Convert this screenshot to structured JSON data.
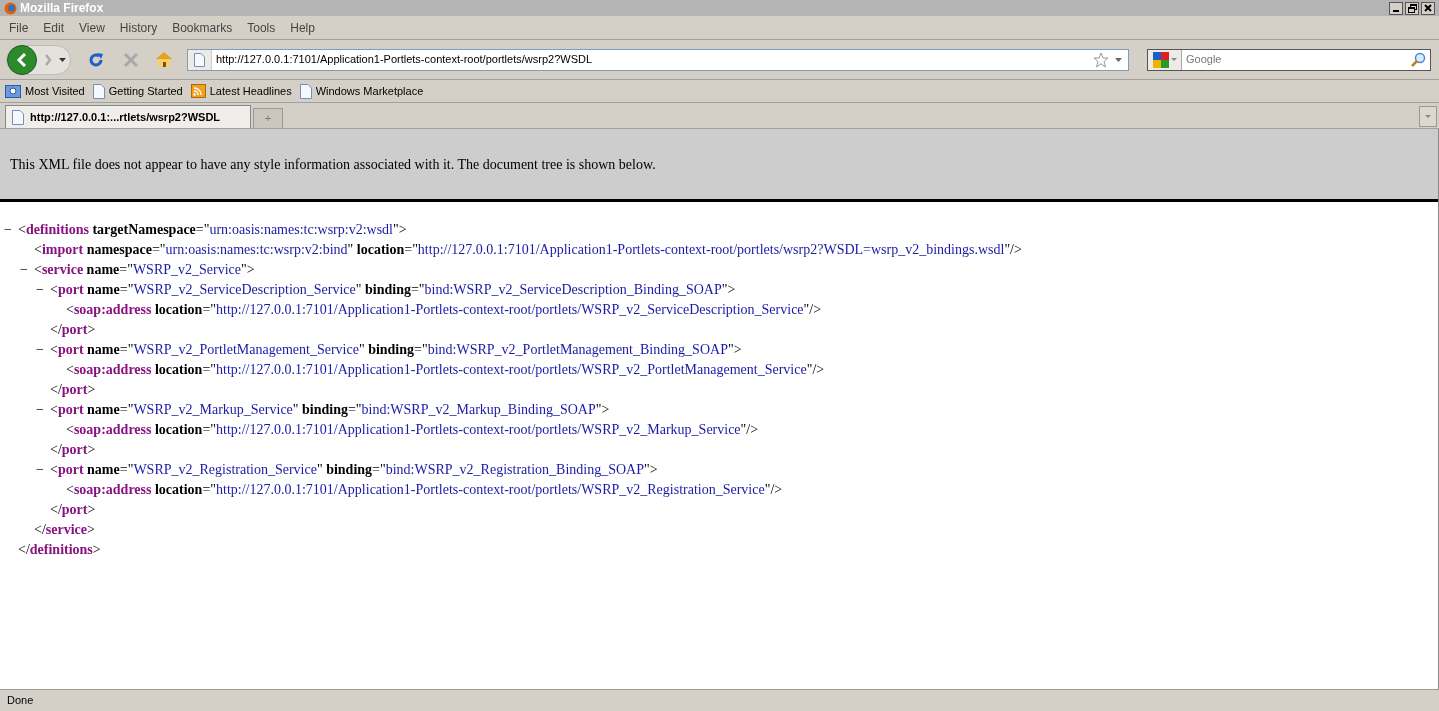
{
  "window": {
    "title": "Mozilla Firefox"
  },
  "menu": [
    "File",
    "Edit",
    "View",
    "History",
    "Bookmarks",
    "Tools",
    "Help"
  ],
  "address_bar": {
    "value": "http://127.0.0.1:7101/Application1-Portlets-context-root/portlets/wsrp2?WSDL"
  },
  "search": {
    "placeholder": "Google"
  },
  "bookmarks": [
    {
      "label": "Most Visited",
      "kind": "folder"
    },
    {
      "label": "Getting Started",
      "kind": "page"
    },
    {
      "label": "Latest Headlines",
      "kind": "feed"
    },
    {
      "label": "Windows Marketplace",
      "kind": "page"
    }
  ],
  "tabs": [
    {
      "label": "http://127.0.0.1:...rtlets/wsrp2?WSDL",
      "selected": true
    }
  ],
  "new_tab": "+",
  "info_message": "This XML file does not appear to have any style information associated with it. The document tree is shown below.",
  "syntax": {
    "open": "<",
    "close": ">",
    "end_open": "</",
    "self_close": "/>",
    "eq": "=",
    "quote": "\"",
    "toggle": "−"
  },
  "document": {
    "tag": "definitions",
    "close_tag": "definitions",
    "expanded": true,
    "attributes": [
      {
        "name": "targetNamespace",
        "value": "urn:oasis:names:tc:wsrp:v2:wsdl"
      }
    ],
    "children": [
      {
        "tag": "import",
        "attributes": [
          {
            "name": "namespace",
            "value": "urn:oasis:names:tc:wsrp:v2:bind"
          },
          {
            "name": "location",
            "value": "http://127.0.0.1:7101/Application1-Portlets-context-root/portlets/wsrp2?WSDL=wsrp_v2_bindings.wsdl"
          }
        ]
      },
      {
        "tag": "service",
        "close_tag": "service",
        "expanded": true,
        "attributes": [
          {
            "name": "name",
            "value": "WSRP_v2_Service"
          }
        ],
        "children": [
          {
            "tag": "port",
            "close_tag": "port",
            "expanded": true,
            "attributes": [
              {
                "name": "name",
                "value": "WSRP_v2_ServiceDescription_Service"
              },
              {
                "name": "binding",
                "value": "bind:WSRP_v2_ServiceDescription_Binding_SOAP"
              }
            ],
            "children": [
              {
                "tag": "soap:address",
                "attributes": [
                  {
                    "name": "location",
                    "value": "http://127.0.0.1:7101/Application1-Portlets-context-root/portlets/WSRP_v2_ServiceDescription_Service"
                  }
                ]
              }
            ]
          },
          {
            "tag": "port",
            "close_tag": "port",
            "expanded": true,
            "attributes": [
              {
                "name": "name",
                "value": "WSRP_v2_PortletManagement_Service"
              },
              {
                "name": "binding",
                "value": "bind:WSRP_v2_PortletManagement_Binding_SOAP"
              }
            ],
            "children": [
              {
                "tag": "soap:address",
                "attributes": [
                  {
                    "name": "location",
                    "value": "http://127.0.0.1:7101/Application1-Portlets-context-root/portlets/WSRP_v2_PortletManagement_Service"
                  }
                ]
              }
            ]
          },
          {
            "tag": "port",
            "close_tag": "port",
            "expanded": true,
            "attributes": [
              {
                "name": "name",
                "value": "WSRP_v2_Markup_Service"
              },
              {
                "name": "binding",
                "value": "bind:WSRP_v2_Markup_Binding_SOAP"
              }
            ],
            "children": [
              {
                "tag": "soap:address",
                "attributes": [
                  {
                    "name": "location",
                    "value": "http://127.0.0.1:7101/Application1-Portlets-context-root/portlets/WSRP_v2_Markup_Service"
                  }
                ]
              }
            ]
          },
          {
            "tag": "port",
            "close_tag": "port",
            "expanded": true,
            "attributes": [
              {
                "name": "name",
                "value": "WSRP_v2_Registration_Service"
              },
              {
                "name": "binding",
                "value": "bind:WSRP_v2_Registration_Binding_SOAP"
              }
            ],
            "children": [
              {
                "tag": "soap:address",
                "attributes": [
                  {
                    "name": "location",
                    "value": "http://127.0.0.1:7101/Application1-Portlets-context-root/portlets/WSRP_v2_Registration_Service"
                  }
                ]
              }
            ]
          }
        ]
      }
    ]
  },
  "status_bar": {
    "text": "Done"
  }
}
